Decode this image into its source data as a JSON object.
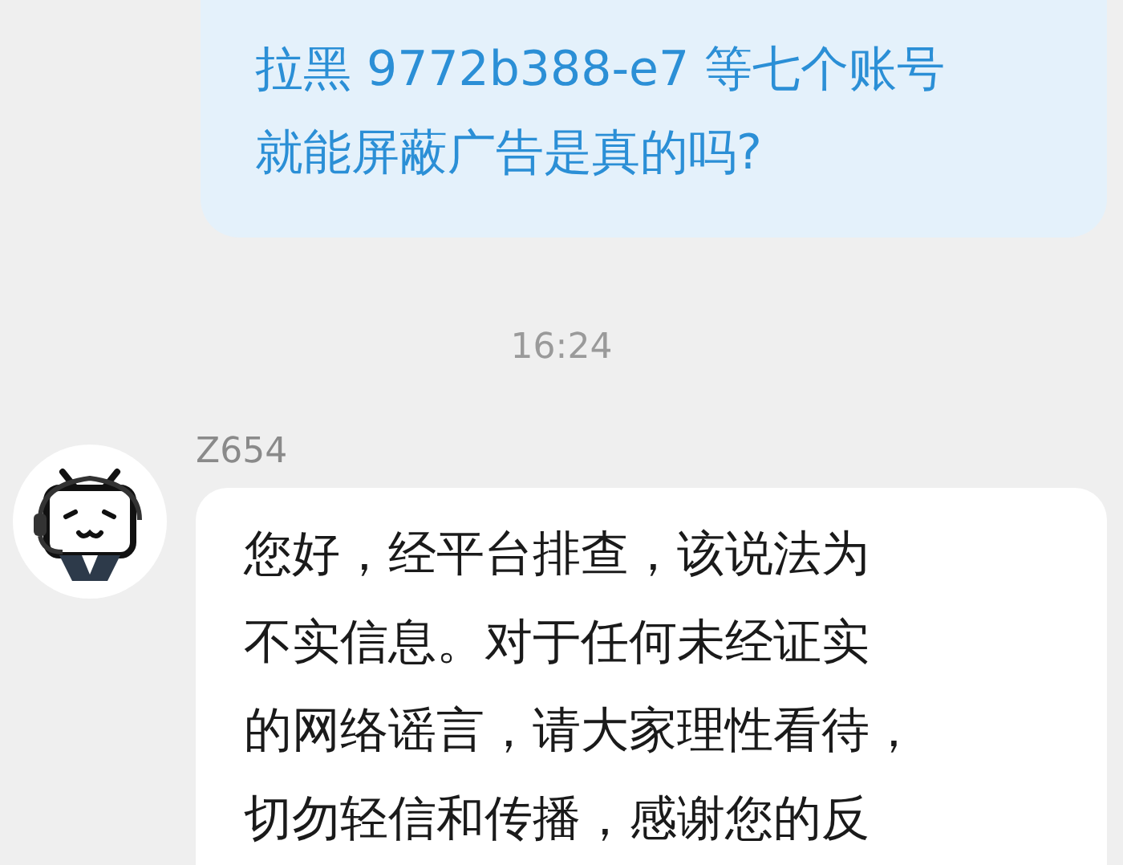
{
  "sent_message": {
    "lines": [
      "拉黑 9772b388-e7 等七个账号",
      "就能屏蔽广告是真的吗?"
    ]
  },
  "timestamp": "16:24",
  "reply": {
    "sender": "Z654",
    "lines": [
      "您好，经平台排查，该说法为",
      "不实信息。对于任何未经证实",
      "的网络谣言，请大家理性看待，",
      "切勿轻信和传播，感谢您的反"
    ]
  }
}
